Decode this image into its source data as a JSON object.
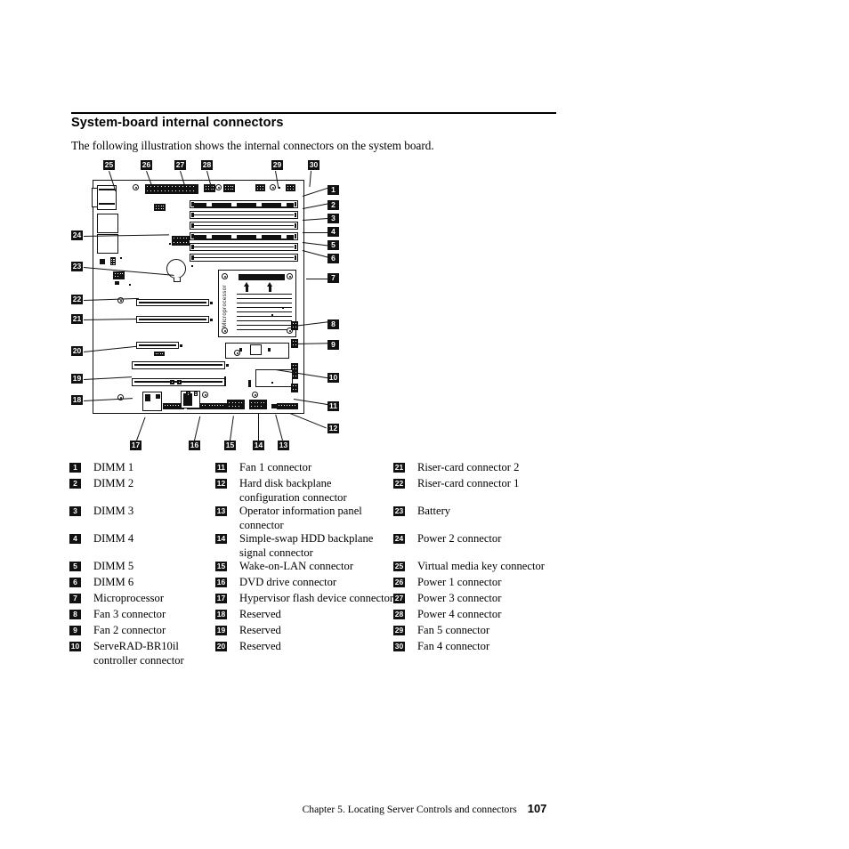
{
  "heading": "System-board internal connectors",
  "intro": "The following illustration shows the internal connectors on the system board.",
  "figure": {
    "cpu_label": "Microprocessor"
  },
  "legend": {
    "columns": [
      [
        {
          "num": "1",
          "text": "DIMM 1"
        },
        {
          "num": "2",
          "text": "DIMM 2"
        },
        {
          "num": "3",
          "text": "DIMM 3"
        },
        {
          "num": "4",
          "text": "DIMM 4"
        },
        {
          "num": "5",
          "text": "DIMM 5"
        },
        {
          "num": "6",
          "text": "DIMM 6"
        },
        {
          "num": "7",
          "text": "Microprocessor"
        },
        {
          "num": "8",
          "text": "Fan 3 connector"
        },
        {
          "num": "9",
          "text": "Fan 2 connector"
        },
        {
          "num": "10",
          "text": "ServeRAD-BR10il controller connector"
        }
      ],
      [
        {
          "num": "11",
          "text": "Fan 1 connector"
        },
        {
          "num": "12",
          "text": "Hard disk backplane configuration connector"
        },
        {
          "num": "13",
          "text": "Operator information panel connector"
        },
        {
          "num": "14",
          "text": "Simple-swap HDD backplane signal connector"
        },
        {
          "num": "15",
          "text": "Wake-on-LAN connector"
        },
        {
          "num": "16",
          "text": "DVD drive connector"
        },
        {
          "num": "17",
          "text": "Hypervisor flash device connector"
        },
        {
          "num": "18",
          "text": "Reserved"
        },
        {
          "num": "19",
          "text": "Reserved"
        },
        {
          "num": "20",
          "text": "Reserved"
        }
      ],
      [
        {
          "num": "21",
          "text": "Riser-card connector 2"
        },
        {
          "num": "22",
          "text": "Riser-card connector 1"
        },
        {
          "num": "23",
          "text": "Battery"
        },
        {
          "num": "24",
          "text": "Power 2 connector"
        },
        {
          "num": "25",
          "text": "Virtual media key connector"
        },
        {
          "num": "26",
          "text": "Power 1 connector"
        },
        {
          "num": "27",
          "text": "Power 3 connector"
        },
        {
          "num": "28",
          "text": "Power 4 connector"
        },
        {
          "num": "29",
          "text": "Fan 5 connector"
        },
        {
          "num": "30",
          "text": "Fan 4 connector"
        }
      ]
    ]
  },
  "callouts": {
    "top": [
      {
        "num": "25"
      },
      {
        "num": "26"
      },
      {
        "num": "27"
      },
      {
        "num": "28"
      },
      {
        "num": "29"
      },
      {
        "num": "30"
      }
    ],
    "right": [
      {
        "num": "1"
      },
      {
        "num": "2"
      },
      {
        "num": "3"
      },
      {
        "num": "4"
      },
      {
        "num": "5"
      },
      {
        "num": "6"
      },
      {
        "num": "7"
      },
      {
        "num": "8"
      },
      {
        "num": "9"
      },
      {
        "num": "10"
      },
      {
        "num": "11"
      },
      {
        "num": "12"
      }
    ],
    "left": [
      {
        "num": "24"
      },
      {
        "num": "23"
      },
      {
        "num": "22"
      },
      {
        "num": "21"
      },
      {
        "num": "20"
      },
      {
        "num": "19"
      },
      {
        "num": "18"
      }
    ],
    "bottom": [
      {
        "num": "17"
      },
      {
        "num": "16"
      },
      {
        "num": "15"
      },
      {
        "num": "14"
      },
      {
        "num": "13"
      }
    ]
  },
  "footer": {
    "chapter": "Chapter 5. Locating Server Controls and connectors",
    "page": "107"
  }
}
